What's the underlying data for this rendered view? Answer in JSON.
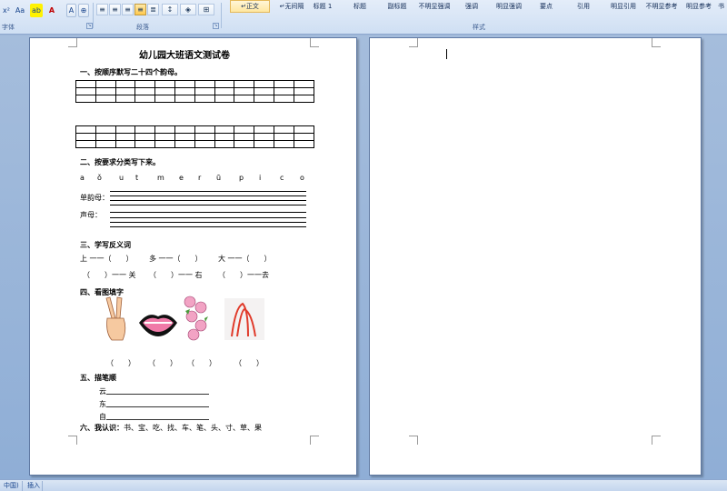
{
  "ribbon": {
    "font_group_label": "字体",
    "paragraph_group_label": "段落",
    "styles_group_label": "样式",
    "font_buttons": [
      "x²",
      "Aa",
      "ab",
      "A",
      "A",
      "⊕"
    ],
    "styles": [
      "正文",
      "无间隔",
      "标题 1",
      "标题",
      "副标题",
      "不明显强调",
      "强调",
      "明显强调",
      "要点",
      "引用",
      "明显引用",
      "不明显参考",
      "明显参考",
      "书"
    ],
    "styles_prefix_icons": [
      "↵",
      "↵"
    ]
  },
  "document": {
    "title": "幼儿园大班语文测试卷",
    "sec1_heading": "一、按顺序默写二十四个韵母。",
    "sec2_heading": "二、按要求分类写下来。",
    "letters": [
      "a",
      "ǒ",
      "u",
      "t",
      "m",
      "e",
      "r",
      "ū",
      "p",
      "i",
      "c",
      "o"
    ],
    "single_final_label": "单韵母：",
    "initial_label": "声母：",
    "sec3_heading": "三、学写反义词",
    "antonym_row1": [
      "上 一一（　　）",
      "多 一一（　　）",
      "大 一一（　　）"
    ],
    "antonym_row2": [
      "（　　）一一 关",
      "（　　）一一 右",
      "（　　）一一去"
    ],
    "sec4_heading": "四、看图填字",
    "picture_answers": [
      "（　　）",
      "（　　）",
      "（　　）",
      "（　　）"
    ],
    "sec5_heading": "五、描笔顺",
    "stroke_chars": [
      "云",
      "东",
      "自"
    ],
    "sec6_heading": "六、我认识：",
    "sec6_chars": "书、宝、吃、找、车、笔、头、寸、草、果"
  },
  "statusbar": {
    "language": "中国)",
    "mode": "插入"
  },
  "colors": {
    "workspace": "#9fb7d8",
    "ribbon": "#dbe7f6",
    "selected_style": "#ffe7a0"
  }
}
